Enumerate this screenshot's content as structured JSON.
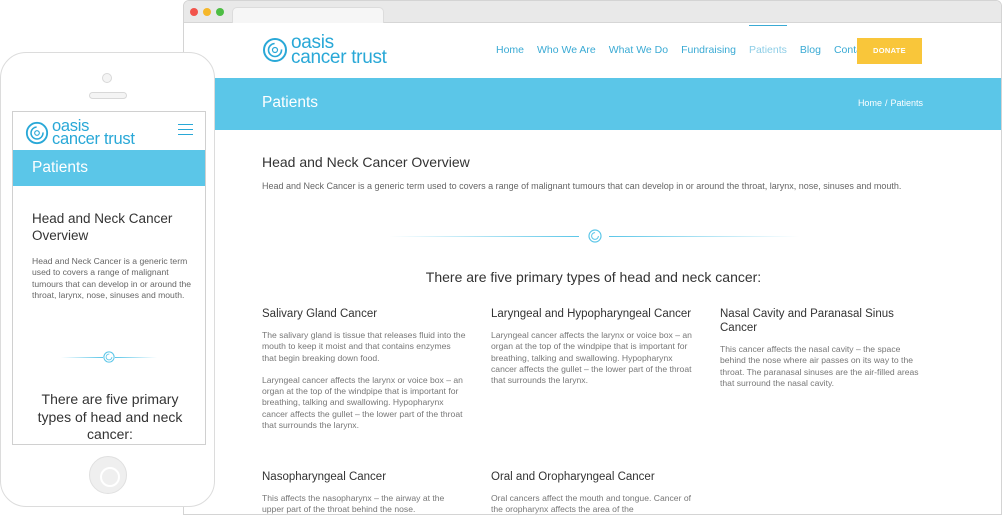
{
  "brand": {
    "line1": "oasis",
    "line2": "cancer trust",
    "color": "#29a8d7"
  },
  "colors": {
    "banner": "#5bc6e8",
    "donate": "#f9c63a",
    "nav": "#3aaad4"
  },
  "nav": {
    "items": [
      {
        "label": "Home"
      },
      {
        "label": "Who We Are"
      },
      {
        "label": "What We Do"
      },
      {
        "label": "Fundraising"
      },
      {
        "label": "Patients",
        "active": true
      },
      {
        "label": "Blog"
      },
      {
        "label": "Contact"
      }
    ],
    "donate_label": "DONATE"
  },
  "banner": {
    "title": "Patients",
    "breadcrumb": {
      "home": "Home",
      "separator": "/",
      "current": "Patients"
    }
  },
  "overview": {
    "heading": "Head and Neck Cancer Overview",
    "text": "Head and Neck Cancer is a generic term used to covers a range of malignant tumours that can develop in or around the throat, larynx, nose, sinuses and mouth.",
    "mobile_text": "Head and Neck Cancer is a generic term used to covers a range of malignant tumours that can develop in or around the throat, larynx, nose, sinuses and mouth."
  },
  "types_heading": "There are five primary types of head and neck cancer:",
  "cancer_types": [
    {
      "title": "Salivary Gland Cancer",
      "paragraphs": [
        "The salivary gland is tissue that releases fluid into the mouth to keep it moist and that contains enzymes that begin breaking down food.",
        "Laryngeal cancer affects the larynx or voice box – an organ at the top of the windpipe that is important for breathing, talking and swallowing. Hypopharynx cancer affects the gullet – the lower part of the throat that surrounds the larynx."
      ]
    },
    {
      "title": "Laryngeal and Hypopharyngeal Cancer",
      "paragraphs": [
        "Laryngeal cancer affects the larynx or voice box – an organ at the top of the windpipe that is important for breathing, talking and swallowing. Hypopharynx cancer affects the gullet – the lower part of the throat that surrounds the larynx."
      ]
    },
    {
      "title": "Nasal Cavity and Paranasal Sinus Cancer",
      "paragraphs": [
        "This cancer affects the nasal cavity – the space behind the nose where air passes on its way to the throat. The paranasal sinuses are the air-filled areas that surround the nasal cavity."
      ]
    },
    {
      "title": "Nasopharyngeal Cancer",
      "paragraphs": [
        "This affects the nasopharynx – the airway at the upper part of the throat behind the nose."
      ]
    },
    {
      "title": "Oral and Oropharyngeal Cancer",
      "paragraphs": [
        "Oral cancers affect the mouth and tongue. Cancer of the oropharynx affects the area of the"
      ]
    }
  ]
}
